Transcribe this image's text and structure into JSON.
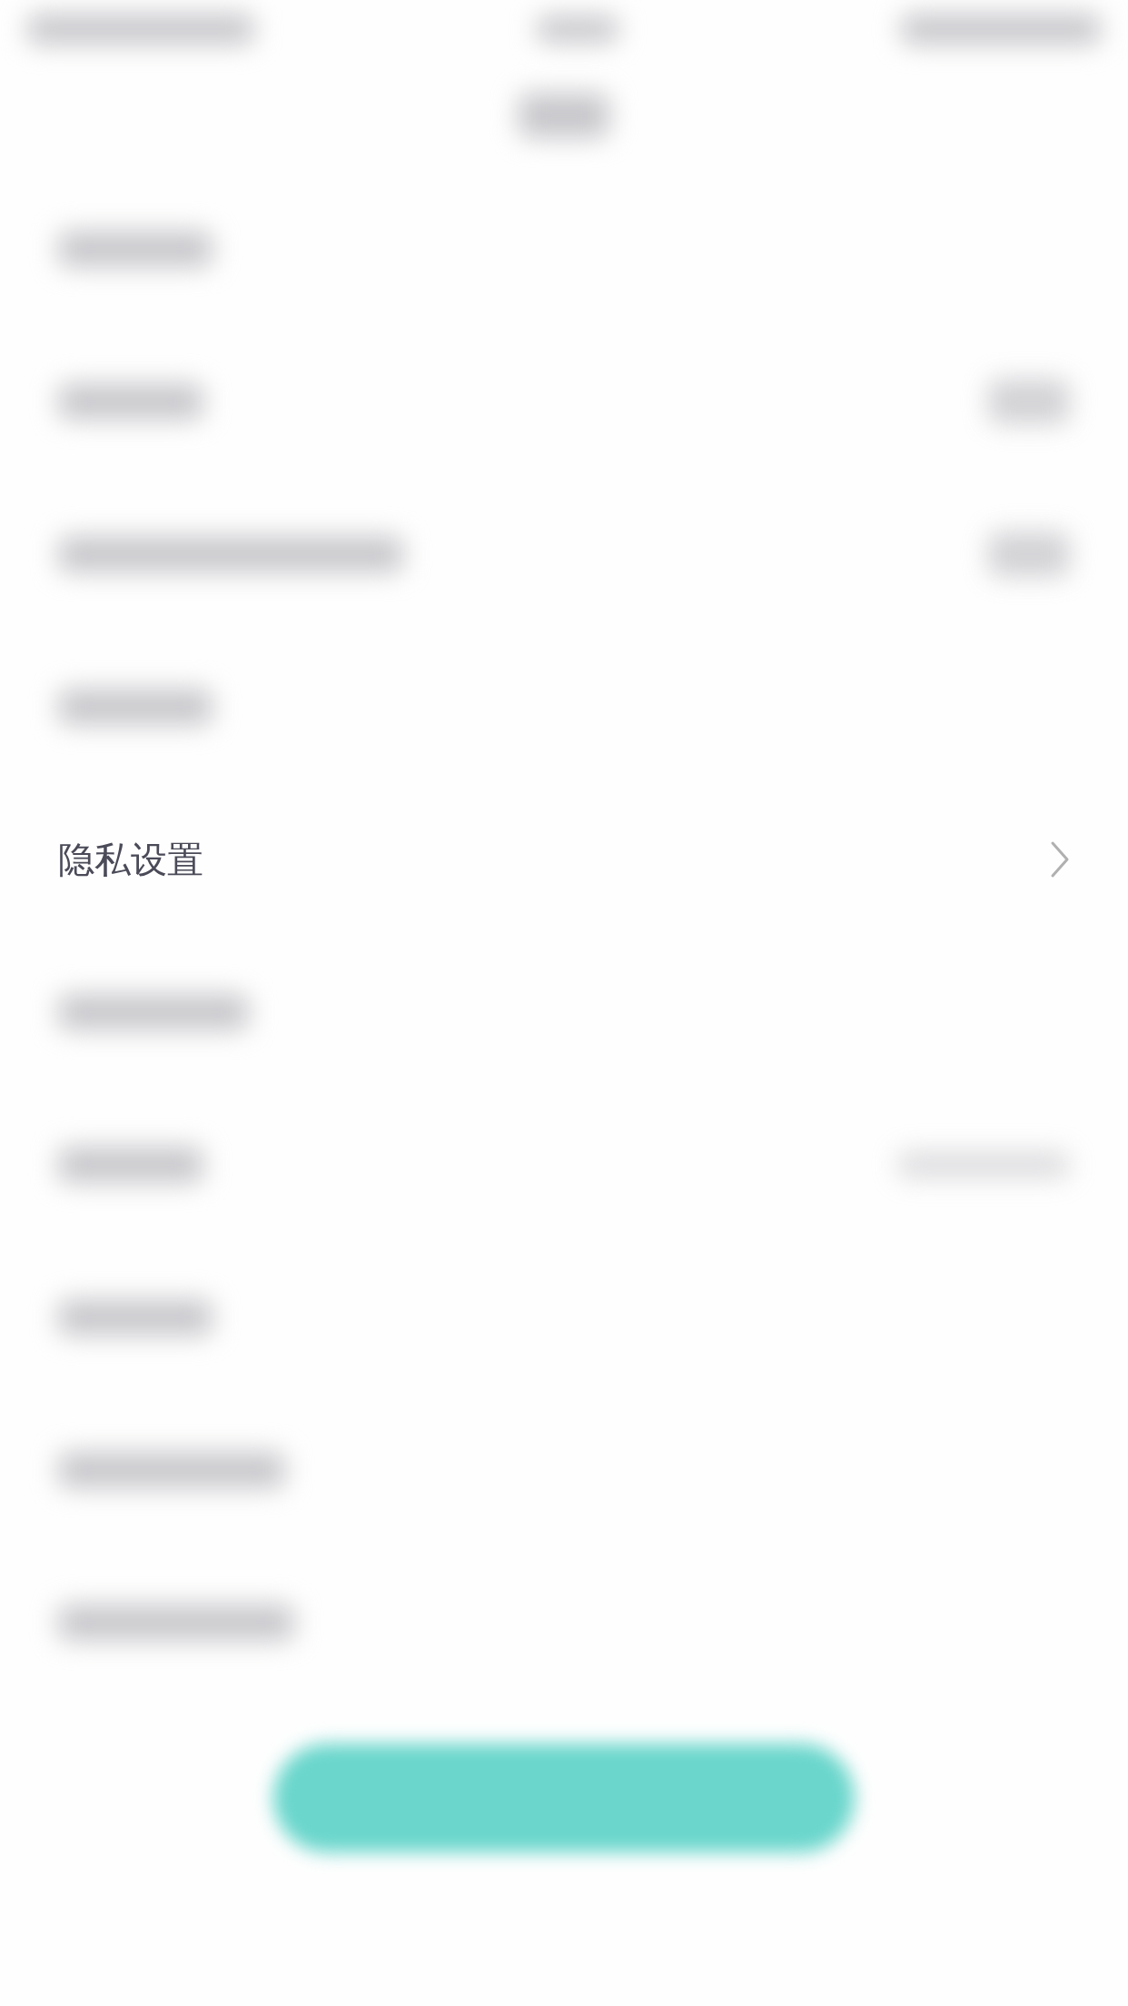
{
  "rows": [
    {
      "kind": "blurred"
    },
    {
      "kind": "blurred_pair"
    },
    {
      "kind": "blurred_pair"
    },
    {
      "kind": "blurred"
    },
    {
      "kind": "clear",
      "label": "隐私设置"
    },
    {
      "kind": "blurred"
    },
    {
      "kind": "blurred_value"
    },
    {
      "kind": "blurred"
    },
    {
      "kind": "blurred"
    },
    {
      "kind": "blurred"
    }
  ],
  "button": {
    "kind": "blurred"
  }
}
